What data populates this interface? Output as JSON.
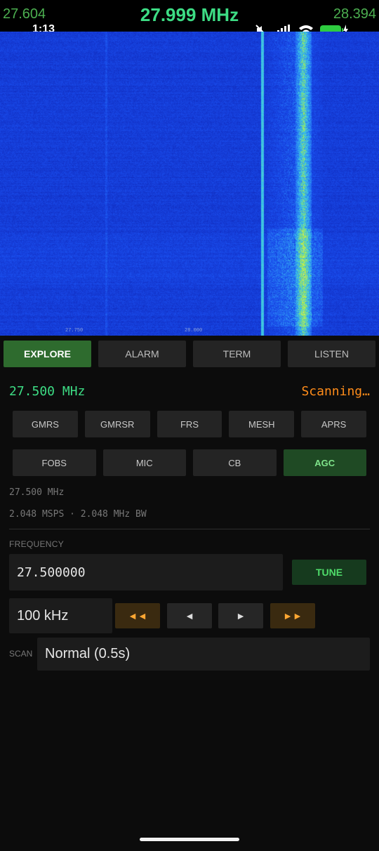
{
  "header": {
    "freq_left": "27.604",
    "freq_center": "27.999 MHz",
    "freq_right": "28.394"
  },
  "status_bar": {
    "time": "1:13",
    "icons": [
      "mute-icon",
      "signal-icon",
      "wifi-icon",
      "battery-charging-icon"
    ],
    "battery_color": "#2ecc40"
  },
  "waterfall": {
    "tick_labels": [
      "27.750",
      "28.000"
    ]
  },
  "tabs": [
    {
      "label": "EXPLORE",
      "active": true
    },
    {
      "label": "ALARM",
      "active": false
    },
    {
      "label": "TERM",
      "active": false
    },
    {
      "label": "LISTEN",
      "active": false
    }
  ],
  "current_frequency": "27.500 MHz",
  "scan_status": "Scanning…",
  "presets_row1": [
    "GMRS",
    "GMRSR",
    "FRS",
    "MESH",
    "APRS"
  ],
  "presets_row2": [
    "FOBS",
    "MIC",
    "CB",
    "AGC"
  ],
  "active_preset": "AGC",
  "info": {
    "line1": "27.500 MHz",
    "line2": "2.048 MSPS · 2.048 MHz BW"
  },
  "frequency_section": {
    "label": "FREQUENCY",
    "value": "27.500000",
    "tune_label": "TUNE"
  },
  "step": {
    "value": "100 kHz",
    "fast_back": "◄◄",
    "back": "◄",
    "forward": "►",
    "fast_forward": "►►"
  },
  "scan": {
    "label": "SCAN",
    "value": "Normal (0.5s)"
  },
  "colors": {
    "accent_green": "#3ddc84",
    "scanning_orange": "#ff8c1a",
    "active_tab": "#2e6b2e",
    "waterfall_base": "#1737c8"
  }
}
